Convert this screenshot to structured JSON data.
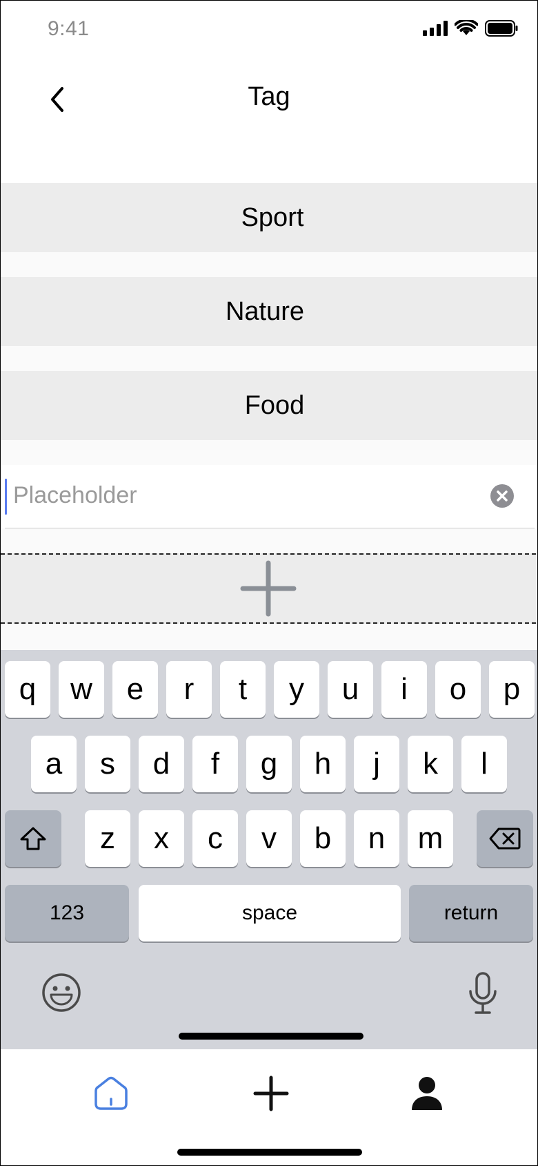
{
  "status_bar": {
    "time": "9:41"
  },
  "nav": {
    "title": "Tag",
    "back_icon": "chevron-left-icon"
  },
  "tags": [
    {
      "label": "Sport"
    },
    {
      "label": "Nature"
    },
    {
      "label": "Food"
    }
  ],
  "tag_input": {
    "placeholder": "Placeholder",
    "value": ""
  },
  "add_tag": {
    "icon": "plus-icon"
  },
  "keyboard": {
    "row1": [
      "q",
      "w",
      "e",
      "r",
      "t",
      "y",
      "u",
      "i",
      "o",
      "p"
    ],
    "row2": [
      "a",
      "s",
      "d",
      "f",
      "g",
      "h",
      "j",
      "k",
      "l"
    ],
    "row3": [
      "z",
      "x",
      "c",
      "v",
      "b",
      "n",
      "m"
    ],
    "numbers_label": "123",
    "space_label": "space",
    "return_label": "return"
  },
  "tab_bar": {
    "items": [
      {
        "name": "home",
        "icon": "home-icon",
        "active": true
      },
      {
        "name": "add",
        "icon": "plus-icon",
        "active": false
      },
      {
        "name": "profile",
        "icon": "user-icon",
        "active": false
      }
    ]
  },
  "colors": {
    "accent": "#4a80e0",
    "cursor": "#5a7cf0",
    "key_dark": "#adb3bd",
    "keyboard_bg": "#d2d4da"
  }
}
